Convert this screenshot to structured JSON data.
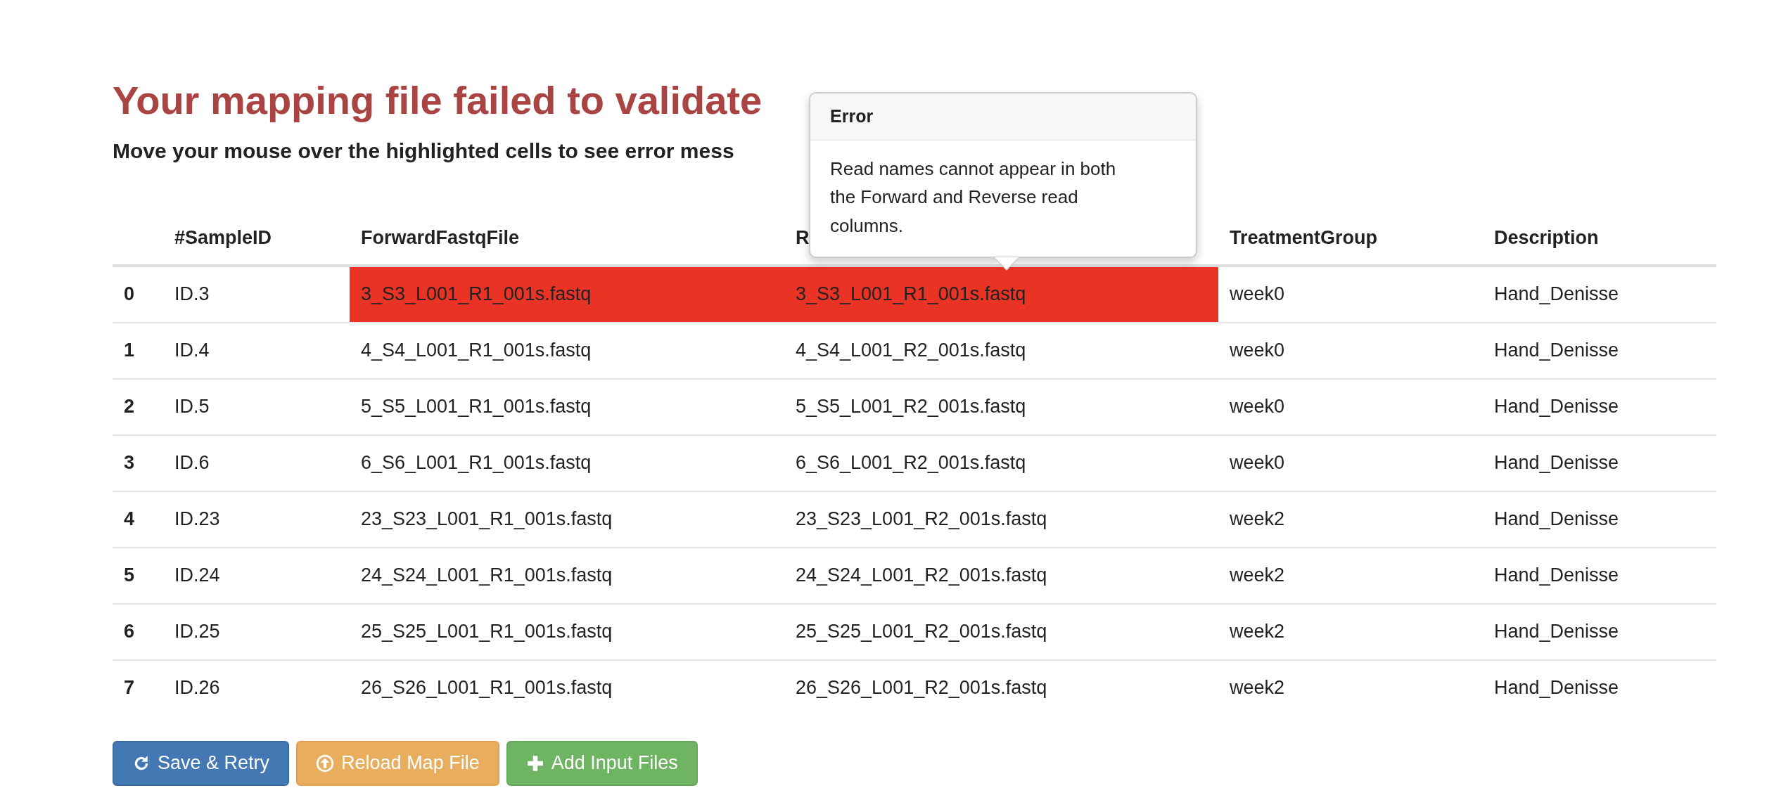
{
  "title": "Your mapping file failed to validate",
  "subtitle": "Move your mouse over the highlighted cells to see error mess",
  "tooltip": {
    "title": "Error",
    "message": "Read names cannot appear in both the Forward and Reverse read columns."
  },
  "table": {
    "columns": [
      "",
      "#SampleID",
      "ForwardFastqFile",
      "R",
      "TreatmentGroup",
      "Description"
    ],
    "rows": [
      {
        "cells": [
          {
            "text": "0",
            "error": false
          },
          {
            "text": "ID.3",
            "error": false
          },
          {
            "text": "3_S3_L001_R1_001s.fastq",
            "error": true
          },
          {
            "text": "3_S3_L001_R1_001s.fastq",
            "error": true
          },
          {
            "text": "week0",
            "error": false
          },
          {
            "text": "Hand_Denisse",
            "error": false
          }
        ]
      },
      {
        "cells": [
          {
            "text": "1",
            "error": false
          },
          {
            "text": "ID.4",
            "error": false
          },
          {
            "text": "4_S4_L001_R1_001s.fastq",
            "error": false
          },
          {
            "text": "4_S4_L001_R2_001s.fastq",
            "error": false
          },
          {
            "text": "week0",
            "error": false
          },
          {
            "text": "Hand_Denisse",
            "error": false
          }
        ]
      },
      {
        "cells": [
          {
            "text": "2",
            "error": false
          },
          {
            "text": "ID.5",
            "error": false
          },
          {
            "text": "5_S5_L001_R1_001s.fastq",
            "error": false
          },
          {
            "text": "5_S5_L001_R2_001s.fastq",
            "error": false
          },
          {
            "text": "week0",
            "error": false
          },
          {
            "text": "Hand_Denisse",
            "error": false
          }
        ]
      },
      {
        "cells": [
          {
            "text": "3",
            "error": false
          },
          {
            "text": "ID.6",
            "error": false
          },
          {
            "text": "6_S6_L001_R1_001s.fastq",
            "error": false
          },
          {
            "text": "6_S6_L001_R2_001s.fastq",
            "error": false
          },
          {
            "text": "week0",
            "error": false
          },
          {
            "text": "Hand_Denisse",
            "error": false
          }
        ]
      },
      {
        "cells": [
          {
            "text": "4",
            "error": false
          },
          {
            "text": "ID.23",
            "error": false
          },
          {
            "text": "23_S23_L001_R1_001s.fastq",
            "error": false
          },
          {
            "text": "23_S23_L001_R2_001s.fastq",
            "error": false
          },
          {
            "text": "week2",
            "error": false
          },
          {
            "text": "Hand_Denisse",
            "error": false
          }
        ]
      },
      {
        "cells": [
          {
            "text": "5",
            "error": false
          },
          {
            "text": "ID.24",
            "error": false
          },
          {
            "text": "24_S24_L001_R1_001s.fastq",
            "error": false
          },
          {
            "text": "24_S24_L001_R2_001s.fastq",
            "error": false
          },
          {
            "text": "week2",
            "error": false
          },
          {
            "text": "Hand_Denisse",
            "error": false
          }
        ]
      },
      {
        "cells": [
          {
            "text": "6",
            "error": false
          },
          {
            "text": "ID.25",
            "error": false
          },
          {
            "text": "25_S25_L001_R1_001s.fastq",
            "error": false
          },
          {
            "text": "25_S25_L001_R2_001s.fastq",
            "error": false
          },
          {
            "text": "week2",
            "error": false
          },
          {
            "text": "Hand_Denisse",
            "error": false
          }
        ]
      },
      {
        "cells": [
          {
            "text": "7",
            "error": false
          },
          {
            "text": "ID.26",
            "error": false
          },
          {
            "text": "26_S26_L001_R1_001s.fastq",
            "error": false
          },
          {
            "text": "26_S26_L001_R2_001s.fastq",
            "error": false
          },
          {
            "text": "week2",
            "error": false
          },
          {
            "text": "Hand_Denisse",
            "error": false
          }
        ]
      }
    ]
  },
  "buttons": [
    {
      "label": "Save & Retry",
      "kind": "primary"
    },
    {
      "label": "Reload Map File",
      "kind": "warning"
    },
    {
      "label": "Add Input Files",
      "kind": "success"
    }
  ]
}
